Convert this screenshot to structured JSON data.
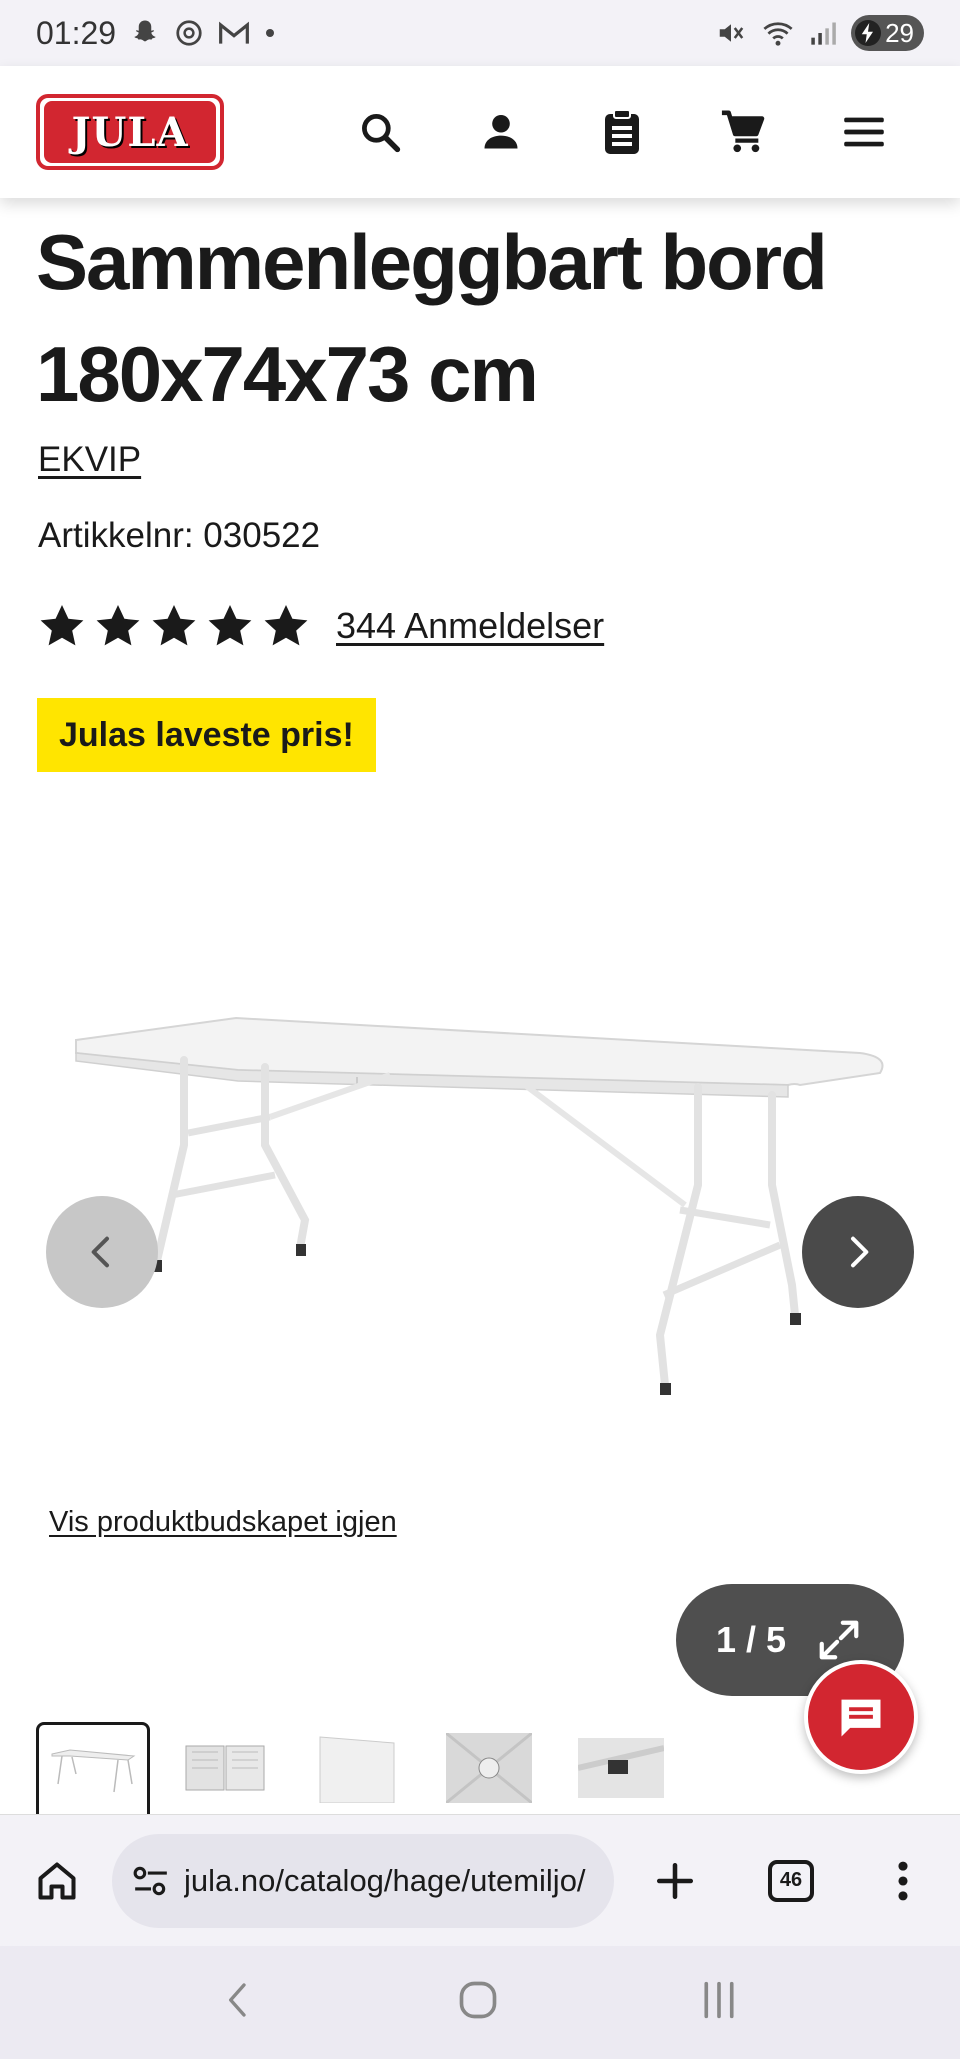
{
  "status_bar": {
    "time": "01:29",
    "notification_icons": [
      "snapchat-icon",
      "threads-icon",
      "gmail-icon",
      "dot-icon"
    ],
    "system_icons": [
      "mute-icon",
      "wifi-icon",
      "signal-icon"
    ],
    "battery": "29"
  },
  "header": {
    "logo_text": "JULA",
    "brand_color": "#d22630",
    "icons": [
      "search-icon",
      "account-icon",
      "shopping-list-icon",
      "cart-icon",
      "menu-icon"
    ]
  },
  "product": {
    "title": "Sammenleggbart bord 180x74x73 cm",
    "brand": "EKVIP",
    "article_number": "Artikkelnr: 030522",
    "rating": 5,
    "rating_max": 5,
    "reviews": "344 Anmeldelser",
    "badge": "Julas laveste pris!",
    "badge_color": "#ffe500"
  },
  "gallery": {
    "show_message_link": "Vis produktbudskapet igjen",
    "counter": "1 / 5",
    "thumbnail_count": 5
  },
  "browser": {
    "url": "jula.no/catalog/hage/utemiljo/",
    "tab_count": "46"
  }
}
